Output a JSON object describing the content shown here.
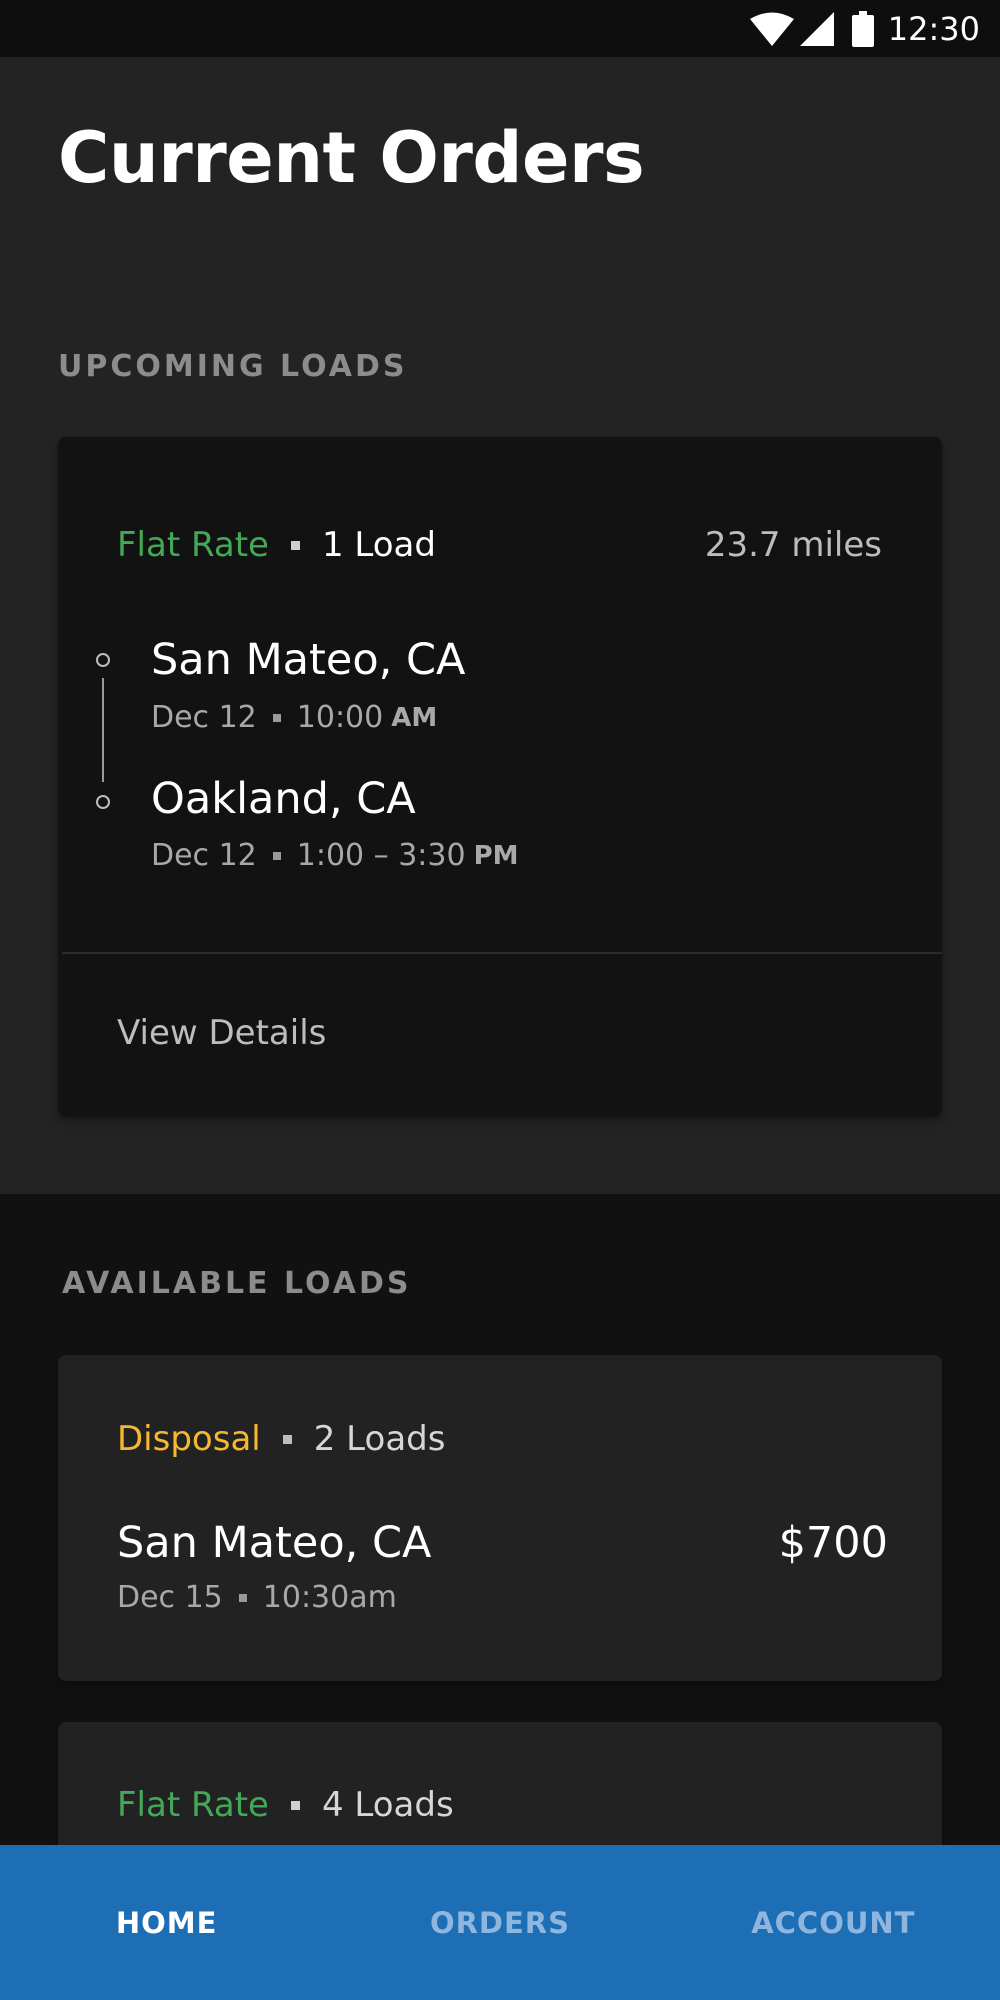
{
  "status_bar": {
    "time": "12:30"
  },
  "title": "Current Orders",
  "upcoming": {
    "section_label": "UPCOMING LOADS",
    "card": {
      "type": "Flat Rate",
      "loads": "1 Load",
      "distance": "23.7 miles",
      "origin": {
        "city": "San Mateo, CA",
        "date": "Dec 12",
        "time": "10:00",
        "ampm": "AM"
      },
      "destination": {
        "city": "Oakland, CA",
        "date": "Dec 12",
        "time": "1:00 – 3:30",
        "ampm": "PM"
      },
      "action": "View Details"
    }
  },
  "available": {
    "section_label": "AVAILABLE LOADS",
    "cards": [
      {
        "type": "Disposal",
        "loads": "2 Loads",
        "city": "San Mateo, CA",
        "date": "Dec 15",
        "time": "10:30am",
        "price": "$700"
      },
      {
        "type": "Flat Rate",
        "loads": "4 Loads"
      }
    ]
  },
  "nav": {
    "items": [
      "HOME",
      "ORDERS",
      "ACCOUNT"
    ],
    "active": "HOME"
  },
  "colors": {
    "flat_rate": "#43a957",
    "disposal": "#f5b82e",
    "nav_bar": "#1d6eb5"
  }
}
